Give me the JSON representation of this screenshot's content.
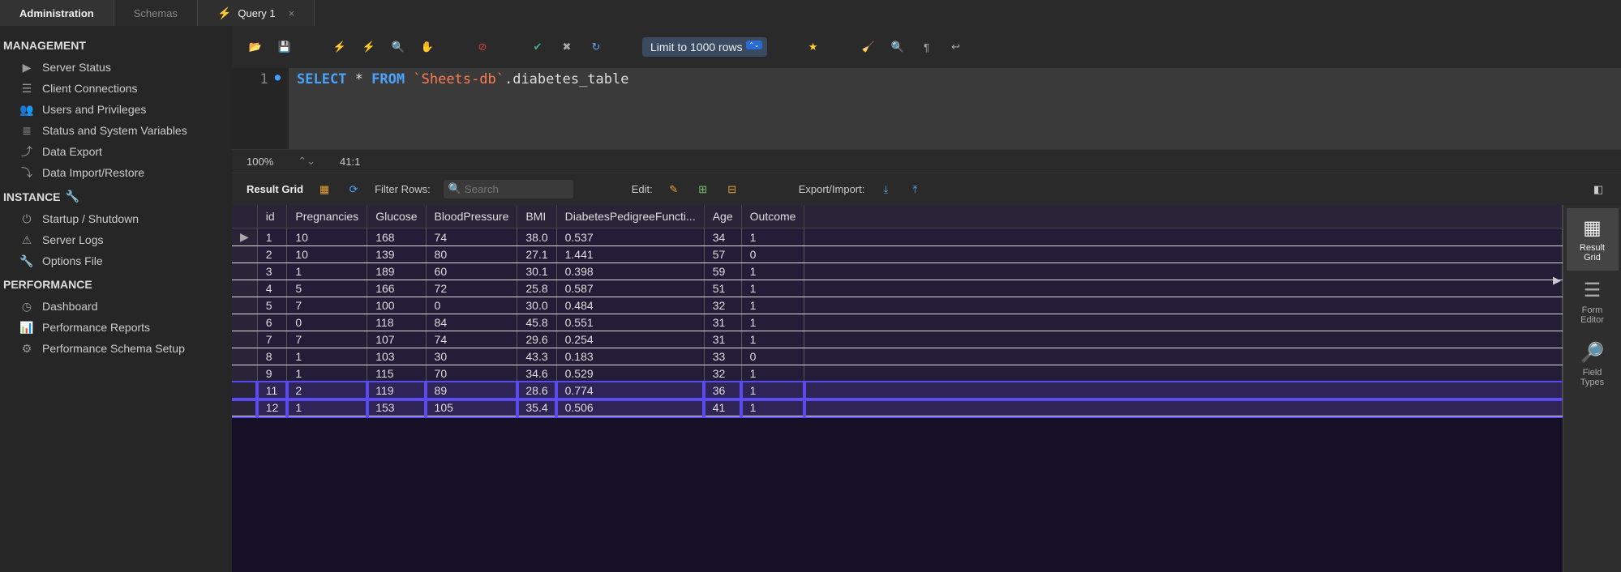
{
  "tabs": {
    "admin": "Administration",
    "schemas": "Schemas",
    "query": "Query 1"
  },
  "sidebar": {
    "management": {
      "title": "MANAGEMENT",
      "items": [
        "Server Status",
        "Client Connections",
        "Users and Privileges",
        "Status and System Variables",
        "Data Export",
        "Data Import/Restore"
      ]
    },
    "instance": {
      "title": "INSTANCE",
      "items": [
        "Startup / Shutdown",
        "Server Logs",
        "Options File"
      ]
    },
    "performance": {
      "title": "PERFORMANCE",
      "items": [
        "Dashboard",
        "Performance Reports",
        "Performance Schema Setup"
      ]
    }
  },
  "toolbar": {
    "limit": "Limit to 1000 rows"
  },
  "editor": {
    "line_number": "1",
    "sql_keyword1": "SELECT",
    "sql_star": "*",
    "sql_keyword2": "FROM",
    "sql_string": "`Sheets-db`",
    "sql_rest": ".diabetes_table"
  },
  "status": {
    "zoom": "100%",
    "cursor": "41:1"
  },
  "result_toolbar": {
    "label": "Result Grid",
    "filter_label": "Filter Rows:",
    "search_placeholder": "Search",
    "edit_label": "Edit:",
    "export_label": "Export/Import:"
  },
  "grid": {
    "columns": [
      "id",
      "Pregnancies",
      "Glucose",
      "BloodPressure",
      "BMI",
      "DiabetesPedigreeFuncti...",
      "Age",
      "Outcome"
    ],
    "rows": [
      {
        "ind": "▶",
        "cells": [
          "1",
          "10",
          "168",
          "74",
          "38.0",
          "0.537",
          "34",
          "1"
        ]
      },
      {
        "ind": "",
        "cells": [
          "2",
          "10",
          "139",
          "80",
          "27.1",
          "1.441",
          "57",
          "0"
        ]
      },
      {
        "ind": "",
        "cells": [
          "3",
          "1",
          "189",
          "60",
          "30.1",
          "0.398",
          "59",
          "1"
        ]
      },
      {
        "ind": "",
        "cells": [
          "4",
          "5",
          "166",
          "72",
          "25.8",
          "0.587",
          "51",
          "1"
        ]
      },
      {
        "ind": "",
        "cells": [
          "5",
          "7",
          "100",
          "0",
          "30.0",
          "0.484",
          "32",
          "1"
        ]
      },
      {
        "ind": "",
        "cells": [
          "6",
          "0",
          "118",
          "84",
          "45.8",
          "0.551",
          "31",
          "1"
        ]
      },
      {
        "ind": "",
        "cells": [
          "7",
          "7",
          "107",
          "74",
          "29.6",
          "0.254",
          "31",
          "1"
        ]
      },
      {
        "ind": "",
        "cells": [
          "8",
          "1",
          "103",
          "30",
          "43.3",
          "0.183",
          "33",
          "0"
        ]
      },
      {
        "ind": "",
        "cells": [
          "9",
          "1",
          "115",
          "70",
          "34.6",
          "0.529",
          "32",
          "1"
        ]
      },
      {
        "ind": "",
        "cells": [
          "11",
          "2",
          "119",
          "89",
          "28.6",
          "0.774",
          "36",
          "1"
        ],
        "hl": true
      },
      {
        "ind": "",
        "cells": [
          "12",
          "1",
          "153",
          "105",
          "35.4",
          "0.506",
          "41",
          "1"
        ],
        "hl": true
      }
    ]
  },
  "rail": {
    "items": [
      {
        "label": "Result\nGrid",
        "active": true
      },
      {
        "label": "Form\nEditor",
        "active": false
      },
      {
        "label": "Field\nTypes",
        "active": false
      }
    ]
  }
}
